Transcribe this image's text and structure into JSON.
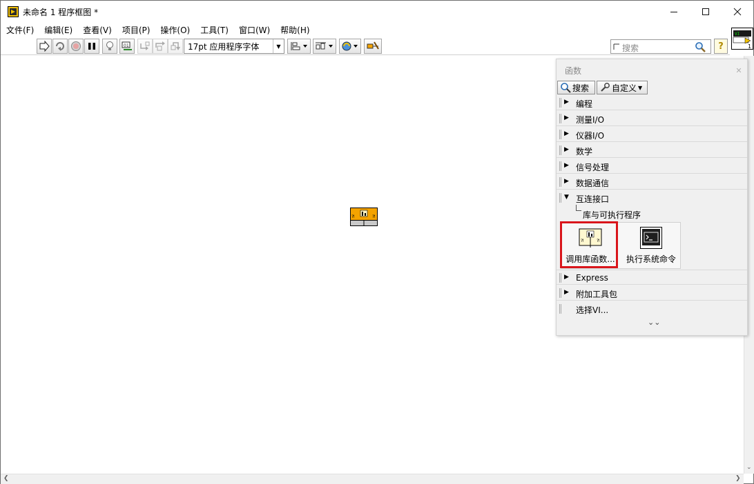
{
  "window": {
    "title": "未命名 1 程序框图 *",
    "icons": {
      "app": "labview-block-diagram-icon",
      "minimize": "minimize-icon",
      "maximize": "maximize-icon",
      "close": "close-icon"
    }
  },
  "menu": [
    "文件(F)",
    "编辑(E)",
    "查看(V)",
    "项目(P)",
    "操作(O)",
    "工具(T)",
    "窗口(W)",
    "帮助(H)"
  ],
  "toolbar": {
    "buttons": [
      "run-arrow-icon",
      "run-continuously-icon",
      "abort-execution-icon",
      "pause-icon",
      "highlight-execution-icon",
      "retain-wire-values-icon",
      "step-into-icon",
      "step-over-icon",
      "step-out-icon",
      "align-objects-icon",
      "distribute-objects-icon",
      "reorder-icon",
      "clean-up-diagram-icon"
    ],
    "font": "17pt 应用程序字体",
    "search_placeholder": "搜索",
    "help_label": "?"
  },
  "vi_icon": {
    "label": "1"
  },
  "palette": {
    "title": "函数",
    "search_button": "搜索",
    "customize_button": "自定义",
    "categories": [
      {
        "label": "编程",
        "expanded": false
      },
      {
        "label": "测量I/O",
        "expanded": false
      },
      {
        "label": "仪器I/O",
        "expanded": false
      },
      {
        "label": "数学",
        "expanded": false
      },
      {
        "label": "信号处理",
        "expanded": false
      },
      {
        "label": "数据通信",
        "expanded": false
      },
      {
        "label": "互连接口",
        "expanded": true
      }
    ],
    "subcategory": "库与可执行程序",
    "items": [
      {
        "label": "调用库函数...",
        "icon": "call-library-function-icon",
        "highlighted": true
      },
      {
        "label": "执行系统命令",
        "icon": "system-exec-terminal-icon",
        "highlighted": false
      }
    ],
    "more_categories": [
      {
        "label": "Express",
        "expanded": false
      },
      {
        "label": "附加工具包",
        "expanded": false
      }
    ],
    "select_vi": "选择VI...",
    "expand_glyph": "⌄⌄"
  },
  "colors": {
    "node_orange": "#f4a300",
    "highlight_red": "#d9151b"
  }
}
